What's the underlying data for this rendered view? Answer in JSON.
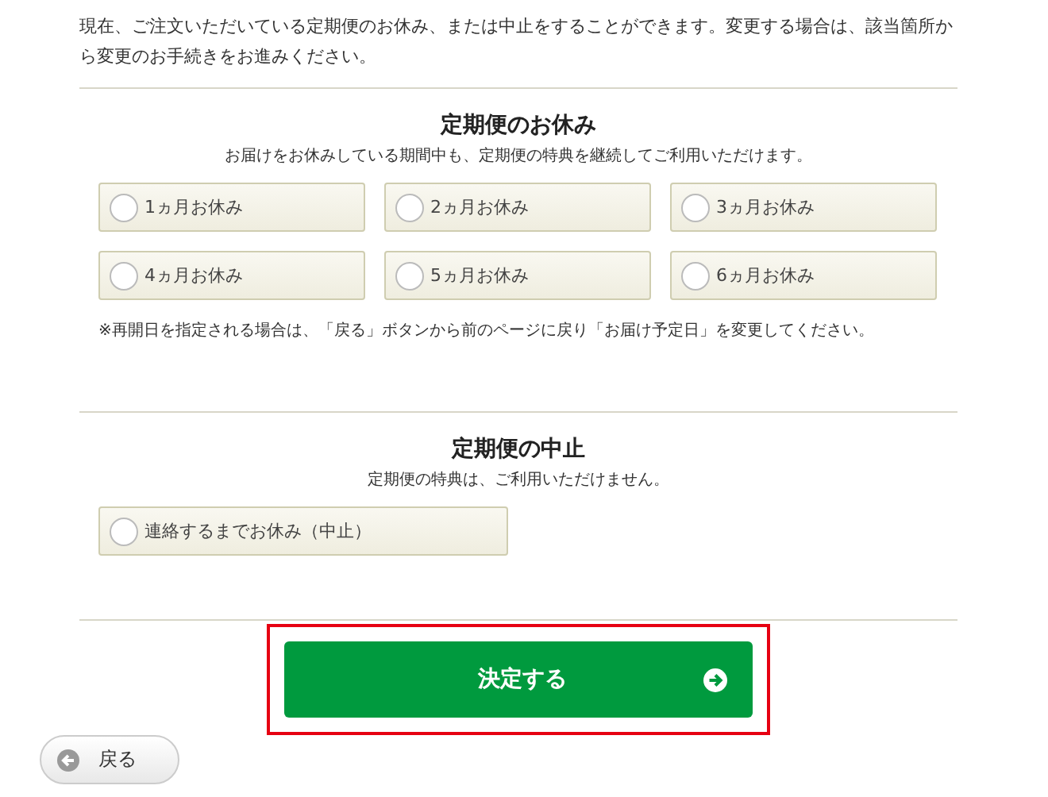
{
  "intro": "現在、ご注文いただいている定期便のお休み、または中止をすることができます。変更する場合は、該当箇所から変更のお手続きをお進みください。",
  "sections": [
    {
      "title": "定期便のお休み",
      "subtitle": "お届けをお休みしている期間中も、定期便の特典を継続してご利用いただけます。",
      "options": [
        {
          "label": "1ヵ月お休み",
          "selected": false
        },
        {
          "label": "2ヵ月お休み",
          "selected": false
        },
        {
          "label": "3ヵ月お休み",
          "selected": false
        },
        {
          "label": "4ヵ月お休み",
          "selected": false
        },
        {
          "label": "5ヵ月お休み",
          "selected": false
        },
        {
          "label": "6ヵ月お休み",
          "selected": false
        }
      ],
      "note": "※再開日を指定される場合は、「戻る」ボタンから前のページに戻り「お届け予定日」を変更してください。"
    },
    {
      "title": "定期便の中止",
      "subtitle": "定期便の特典は、ご利用いただけません。",
      "options": [
        {
          "label": "連絡するまでお休み（中止）",
          "selected": false
        }
      ]
    }
  ],
  "submit": {
    "label": "決定する",
    "highlighted": true
  },
  "back": {
    "label": "戻る"
  }
}
